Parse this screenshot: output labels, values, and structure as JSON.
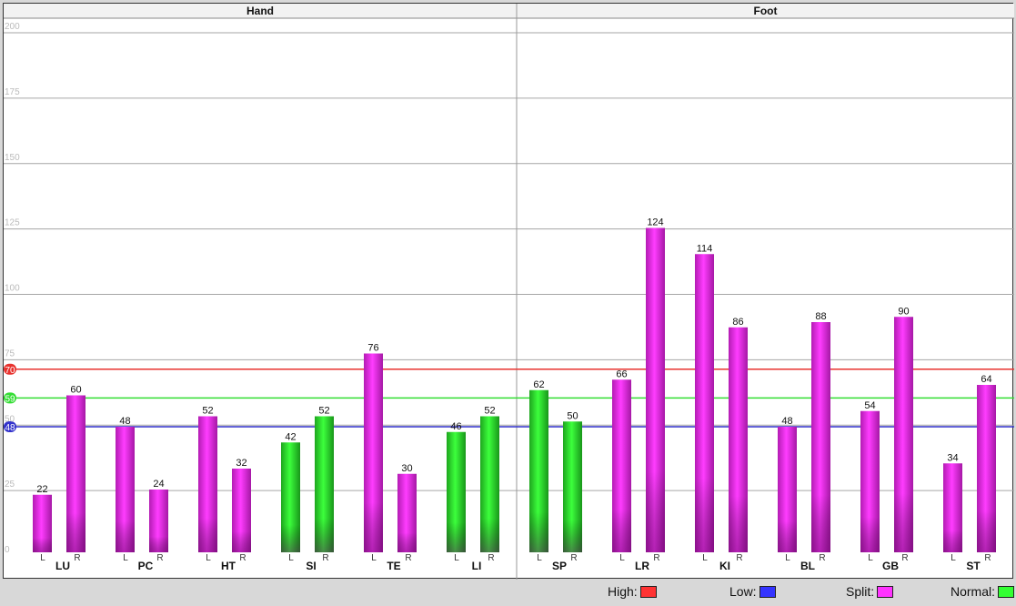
{
  "chart_data": {
    "type": "bar",
    "groups": [
      {
        "name": "Hand",
        "meridians": [
          {
            "name": "LU",
            "L": 22,
            "R": 60,
            "color": "split"
          },
          {
            "name": "PC",
            "L": 48,
            "R": 24,
            "color": "split"
          },
          {
            "name": "HT",
            "L": 52,
            "R": 32,
            "color": "split"
          },
          {
            "name": "SI",
            "L": 42,
            "R": 52,
            "color": "normal"
          },
          {
            "name": "TE",
            "L": 76,
            "R": 30,
            "color": "split"
          },
          {
            "name": "LI",
            "L": 46,
            "R": 52,
            "color": "normal"
          }
        ]
      },
      {
        "name": "Foot",
        "meridians": [
          {
            "name": "SP",
            "L": 62,
            "R": 50,
            "color": "normal"
          },
          {
            "name": "LR",
            "L": 66,
            "R": 124,
            "color": "split"
          },
          {
            "name": "KI",
            "L": 114,
            "R": 86,
            "color": "split"
          },
          {
            "name": "BL",
            "L": 48,
            "R": 88,
            "color": "split"
          },
          {
            "name": "GB",
            "L": 54,
            "R": 90,
            "color": "split"
          },
          {
            "name": "ST",
            "L": 34,
            "R": 64,
            "color": "split"
          }
        ]
      }
    ],
    "side_labels": [
      "L",
      "R"
    ],
    "y_ticks": [
      0,
      25,
      50,
      75,
      100,
      125,
      150,
      175,
      200
    ],
    "ylim": [
      0,
      200
    ],
    "thresholds": [
      {
        "name": "high",
        "value": 70,
        "color": "#e8322e"
      },
      {
        "name": "normal",
        "value": 59,
        "color": "#33dd33"
      },
      {
        "name": "low",
        "value": 48,
        "color": "#3333cc"
      }
    ],
    "grid": true
  },
  "legend": {
    "high_label": "High:",
    "low_label": "Low:",
    "split_label": "Split:",
    "normal_label": "Normal:"
  },
  "colors": {
    "high": "#ff3333",
    "low": "#3333ff",
    "split": "#ff33ff",
    "normal": "#33ff33"
  }
}
